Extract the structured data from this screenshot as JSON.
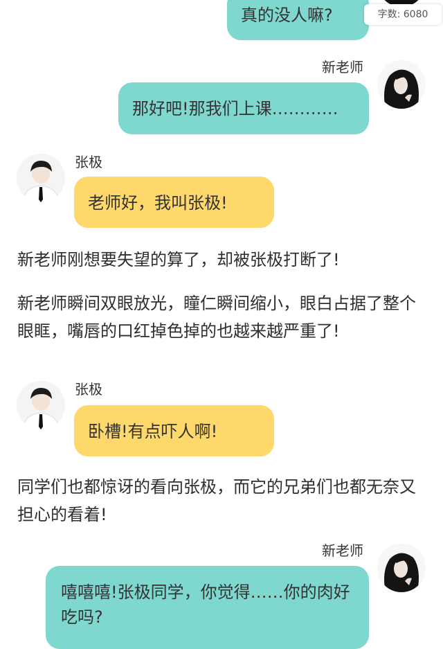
{
  "status": {
    "word_count_label": "字数: 6080"
  },
  "messages": [
    {
      "speaker": "",
      "text": "真的没人嘛?"
    },
    {
      "speaker": "新老师",
      "text": "那好吧!那我们上课…………"
    },
    {
      "speaker": "张极",
      "text": "老师好，我叫张极!"
    },
    {
      "speaker": "",
      "text": "新老师刚想要失望的算了，却被张极打断了!"
    },
    {
      "speaker": "",
      "text": "新老师瞬间双眼放光，瞳仁瞬间缩小，眼白占据了整个眼眶，嘴唇的口红掉色掉的也越来越严重了!"
    },
    {
      "speaker": "张极",
      "text": "卧槽!有点吓人啊!"
    },
    {
      "speaker": "",
      "text": "同学们也都惊讶的看向张极，而它的兄弟们也都无奈又担心的看着!"
    },
    {
      "speaker": "新老师",
      "text": "嘻嘻嘻!张极同学，你觉得……你的肉好吃吗?"
    }
  ],
  "colors": {
    "teacher_bubble": "#7fd8cf",
    "student_bubble": "#fed86a"
  },
  "icons": {
    "teacher_avatar": "teacher-avatar-photo",
    "student_avatar": "student-avatar-photo"
  }
}
